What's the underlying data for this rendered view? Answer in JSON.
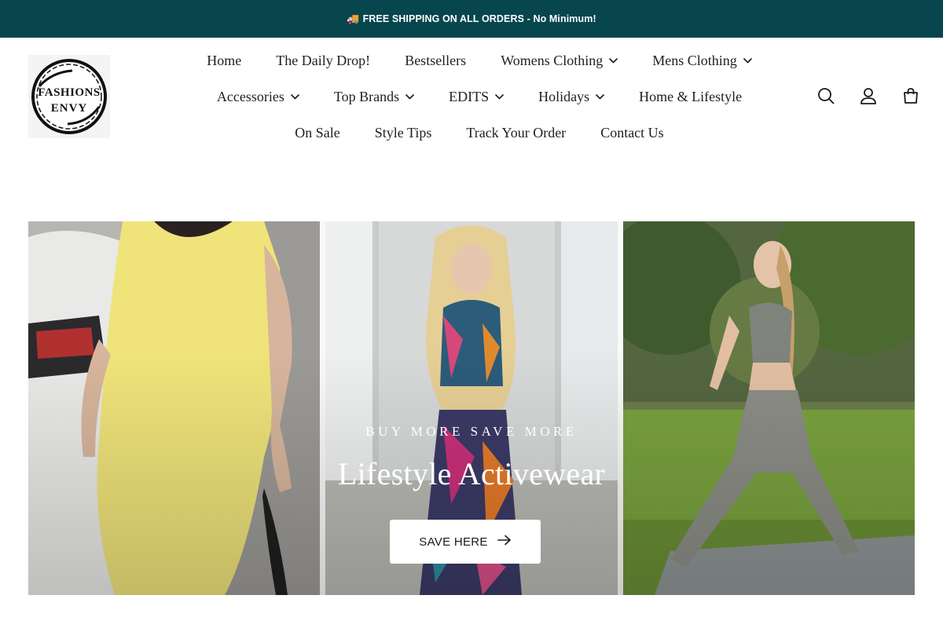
{
  "announcement": {
    "icon": "truck-icon",
    "emoji": "🚚",
    "text": "FREE SHIPPING ON ALL ORDERS - No Minimum!"
  },
  "brand": {
    "logo_text_line1": "FASHIONS",
    "logo_text_line2": "ENVY"
  },
  "nav": {
    "row1": [
      {
        "label": "Home",
        "dropdown": false
      },
      {
        "label": "The Daily Drop!",
        "dropdown": false
      },
      {
        "label": "Bestsellers",
        "dropdown": false
      },
      {
        "label": "Womens Clothing",
        "dropdown": true
      },
      {
        "label": "Mens Clothing",
        "dropdown": true
      }
    ],
    "row2": [
      {
        "label": "Accessories",
        "dropdown": true
      },
      {
        "label": "Top Brands",
        "dropdown": true
      },
      {
        "label": "EDITS",
        "dropdown": true
      },
      {
        "label": "Holidays",
        "dropdown": true
      },
      {
        "label": "Home & Lifestyle",
        "dropdown": false
      }
    ],
    "row3": [
      {
        "label": "On Sale",
        "dropdown": false
      },
      {
        "label": "Style Tips",
        "dropdown": false
      },
      {
        "label": "Track Your Order",
        "dropdown": false
      },
      {
        "label": "Contact Us",
        "dropdown": false
      }
    ]
  },
  "header_icons": [
    "search-icon",
    "account-icon",
    "cart-icon"
  ],
  "hero": {
    "subheading": "BUY MORE SAVE MORE",
    "title": "Lifestyle Activewear",
    "button_label": "SAVE HERE",
    "button_icon": "arrow-right-icon"
  },
  "colors": {
    "announcement_bg": "#07464d",
    "text": "#1f1f1f",
    "hero_text": "#ffffff"
  }
}
